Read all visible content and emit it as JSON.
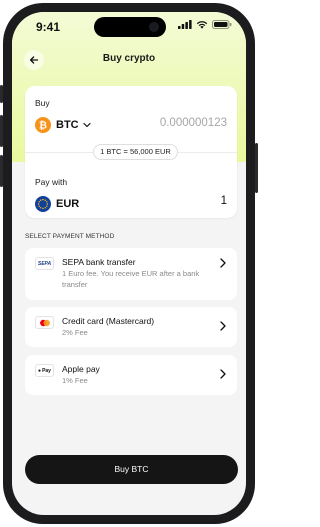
{
  "status": {
    "time": "9:41"
  },
  "header": {
    "title": "Buy crypto"
  },
  "buy": {
    "label": "Buy",
    "currency": "BTC",
    "amount_placeholder": "0.000000123",
    "rate": "1 BTC = 56,000 EUR"
  },
  "pay": {
    "label": "Pay with",
    "currency": "EUR",
    "amount": "1"
  },
  "payment_methods": {
    "section_label": "SELECT PAYMENT METHOD",
    "items": [
      {
        "logo": "SEPA",
        "title": "SEPA bank transfer",
        "subtitle": "1 Euro fee. You receive EUR after a bank transfer"
      },
      {
        "logo": "mastercard",
        "title": "Credit card (Mastercard)",
        "subtitle": "2% Fee"
      },
      {
        "logo": "Pay",
        "title": "Apple pay",
        "subtitle": "1% Fee"
      }
    ]
  },
  "footer": {
    "buy_button": "Buy BTC"
  },
  "colors": {
    "accent_gradient_top": "#f3fbd6",
    "accent_gradient_bottom": "#e9f99d",
    "btc": "#f7931a",
    "eur": "#123e9c",
    "button": "#151515"
  }
}
